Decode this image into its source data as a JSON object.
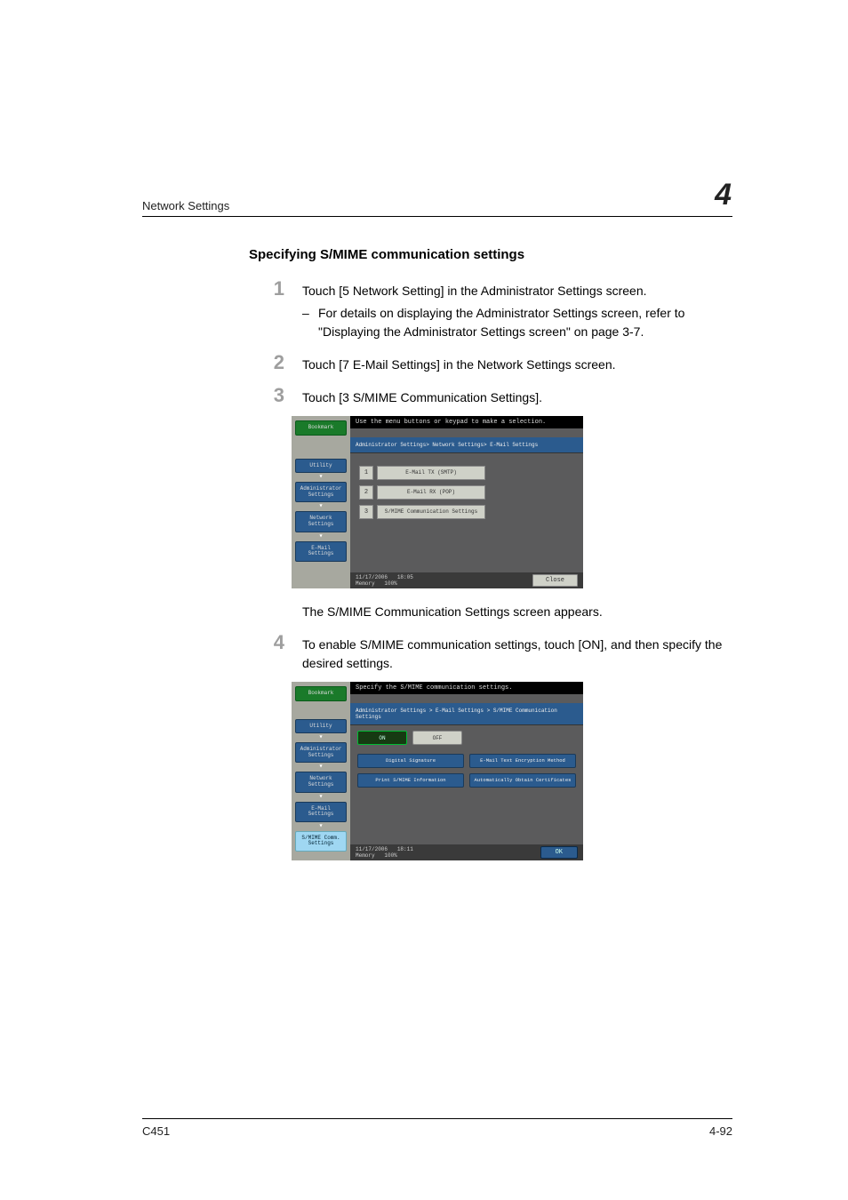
{
  "header": {
    "section": "Network Settings",
    "chapter": "4"
  },
  "heading": "Specifying S/MIME communication settings",
  "steps": {
    "1": {
      "text": "Touch [5 Network Setting] in the Administrator Settings screen.",
      "sub": "For details on displaying the Administrator Settings screen, refer to \"Displaying the Administrator Settings screen\" on page 3-7."
    },
    "2": {
      "text": "Touch [7 E-Mail Settings] in the Network Settings screen."
    },
    "3": {
      "text": "Touch [3 S/MIME Communication Settings]."
    },
    "4": {
      "text": "To enable S/MIME communication settings, touch [ON], and then specify the desired settings."
    }
  },
  "after_panel1": "The S/MIME Communication Settings screen appears.",
  "panel1": {
    "instruction": "Use the menu buttons or keypad to make a selection.",
    "breadcrumb": "Administrator Settings> Network Settings> E-Mail Settings",
    "side": {
      "bookmark": "Bookmark",
      "utility": "Utility",
      "admin": "Administrator Settings",
      "network": "Network Settings",
      "email": "E-Mail Settings"
    },
    "menu": [
      {
        "n": "1",
        "label": "E-Mail TX (SMTP)"
      },
      {
        "n": "2",
        "label": "E-Mail RX (POP)"
      },
      {
        "n": "3",
        "label": "S/MIME Communication Settings"
      }
    ],
    "status": {
      "date": "11/17/2006",
      "time": "18:05",
      "mem_label": "Memory",
      "mem": "100%"
    },
    "close": "Close"
  },
  "panel2": {
    "instruction": "Specify the S/MIME communication settings.",
    "breadcrumb": "Administrator Settings > E-Mail Settings > S/MIME Communication Settings",
    "on": "ON",
    "off": "OFF",
    "side": {
      "bookmark": "Bookmark",
      "utility": "Utility",
      "admin": "Administrator Settings",
      "network": "Network Settings",
      "email": "E-Mail Settings",
      "smime": "S/MIME Comm. Settings"
    },
    "settings": {
      "sig": "Digital Signature",
      "enc": "E-Mail Text Encryption Method",
      "print": "Print S/MIME Information",
      "cert": "Automatically Obtain Certificates"
    },
    "status": {
      "date": "11/17/2006",
      "time": "18:11",
      "mem_label": "Memory",
      "mem": "100%"
    },
    "ok": "OK"
  },
  "footer": {
    "model": "C451",
    "page": "4-92"
  }
}
